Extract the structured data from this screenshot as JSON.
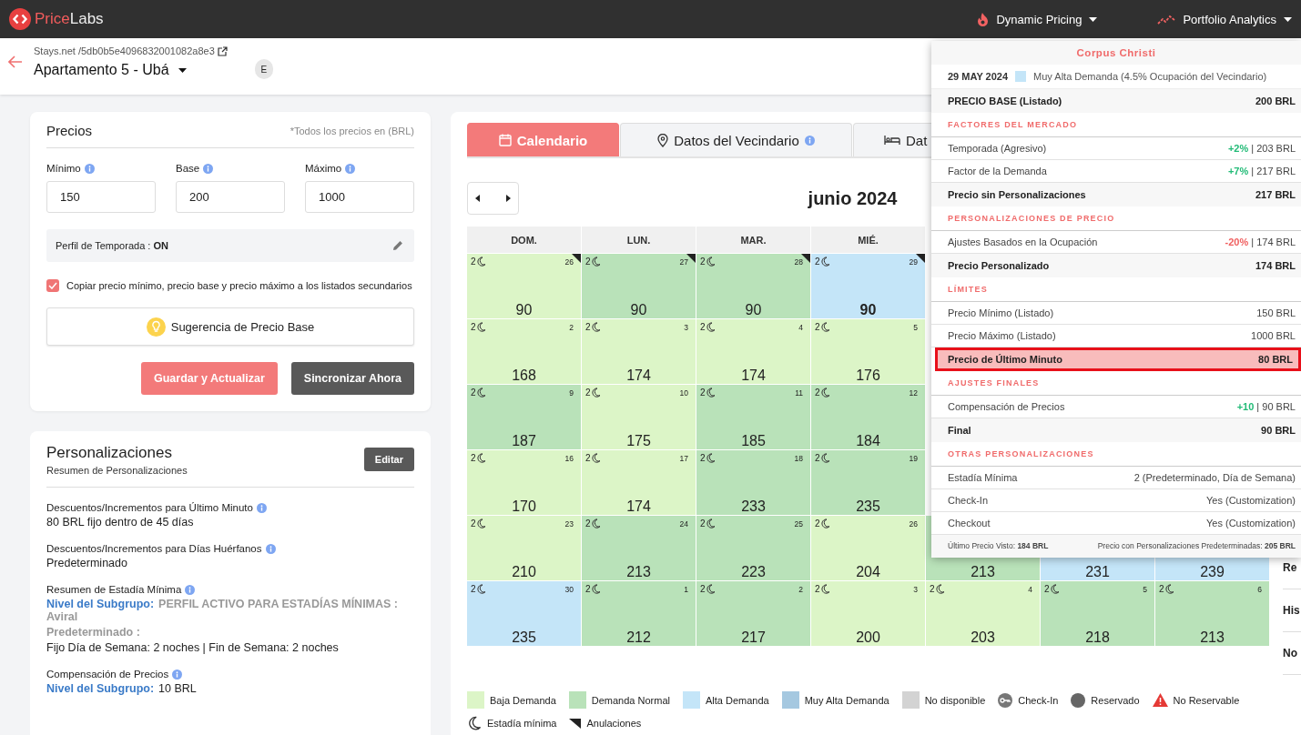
{
  "topbar": {
    "brand_first": "Price",
    "brand_second": "Labs",
    "menus": [
      {
        "label": "Dynamic Pricing"
      },
      {
        "label": "Portfolio Analytics"
      }
    ]
  },
  "listing": {
    "source": "Stays.net /5db0b5e4096832001082a8e3",
    "name": "Apartamento 5 - Ubá",
    "badge": "E"
  },
  "prices": {
    "title": "Precios",
    "note": "*Todos los precios en (BRL)",
    "fields": [
      {
        "label": "Mínimo",
        "value": "150"
      },
      {
        "label": "Base",
        "value": "200"
      },
      {
        "label": "Máximo",
        "value": "1000"
      }
    ],
    "season_profile": "Perfil de Temporada : **ON**",
    "copy_option": {
      "label": "Copiar precio mínimo, precio base y precio máximo a los listados secundarios",
      "checked": true
    },
    "suggest_button": "Sugerencia de Precio Base",
    "buttons": [
      {
        "label": "Guardar y Actualizar",
        "kind": "primary"
      },
      {
        "label": "Sincronizar Ahora",
        "kind": "dark"
      }
    ]
  },
  "customizations": {
    "title": "Personalizaciones",
    "subtitle": "Resumen de Personalizaciones",
    "edit_button": "Editar",
    "items": [
      {
        "label": "Descuentos/Incrementos para Último Minuto",
        "lines": [
          {
            "text": "80 BRL fijo dentro de 45 días",
            "muted": false
          }
        ]
      },
      {
        "label": "Descuentos/Incrementos para Días Huérfanos",
        "lines": [
          {
            "text": "Predeterminado",
            "muted": false
          }
        ]
      },
      {
        "label": "Resumen de Estadía Mínima",
        "lines": [
          {
            "lead": "Nivel del Subgrupo:",
            "text": "PERFIL ACTIVO PARA ESTADÍAS MÍNIMAS : Aviral",
            "muted": true
          },
          {
            "text": "Predeterminado :",
            "muted": true
          },
          {
            "text": "Fijo Día de Semana: 2 noches | Fin de Semana: 2 noches",
            "muted": false
          }
        ]
      },
      {
        "label": "Compensación de Precios",
        "lines": [
          {
            "lead": "Nivel del Subgrupo:",
            "text": "10 BRL",
            "muted": false
          }
        ]
      }
    ]
  },
  "calendar": {
    "tabs": [
      {
        "label": "Calendario",
        "info": false,
        "selected": true
      },
      {
        "label": "Datos del Vecindario",
        "info": true,
        "selected": false
      },
      {
        "label": "Dat",
        "info": false,
        "selected": false
      }
    ],
    "month": "junio 2024",
    "weekdays": [
      "DOM.",
      "LUN.",
      "MAR.",
      "MIÉ."
    ],
    "weeks": [
      [
        {
          "day": "26",
          "min_stay": "2",
          "price": "90",
          "color": "#dcf5c7",
          "cancellation": true,
          "selected": false
        },
        {
          "day": "27",
          "min_stay": "2",
          "price": "90",
          "color": "#b9e2b9",
          "cancellation": true,
          "selected": false
        },
        {
          "day": "28",
          "min_stay": "2",
          "price": "90",
          "color": "#b9e2b9",
          "cancellation": true,
          "selected": false
        },
        {
          "day": "29",
          "min_stay": "2",
          "price": "90",
          "color": "#c4e5f8",
          "cancellation": true,
          "selected": true
        }
      ],
      [
        {
          "day": "2",
          "min_stay": "2",
          "price": "168",
          "color": "#dcf5c7",
          "cancellation": false,
          "selected": false
        },
        {
          "day": "3",
          "min_stay": "2",
          "price": "174",
          "color": "#dcf5c7",
          "cancellation": false,
          "selected": false
        },
        {
          "day": "4",
          "min_stay": "2",
          "price": "174",
          "color": "#dcf5c7",
          "cancellation": false,
          "selected": false
        },
        {
          "day": "5",
          "min_stay": "2",
          "price": "176",
          "color": "#dcf5c7",
          "cancellation": false,
          "selected": false
        }
      ],
      [
        {
          "day": "9",
          "min_stay": "2",
          "price": "187",
          "color": "#b9e2b9",
          "cancellation": false,
          "selected": false
        },
        {
          "day": "10",
          "min_stay": "2",
          "price": "175",
          "color": "#dcf5c7",
          "cancellation": false,
          "selected": false
        },
        {
          "day": "11",
          "min_stay": "2",
          "price": "185",
          "color": "#b9e2b9",
          "cancellation": false,
          "selected": false
        },
        {
          "day": "12",
          "min_stay": "2",
          "price": "184",
          "color": "#b9e2b9",
          "cancellation": false,
          "selected": false
        }
      ],
      [
        {
          "day": "16",
          "min_stay": "2",
          "price": "170",
          "color": "#dcf5c7",
          "cancellation": false,
          "selected": false
        },
        {
          "day": "17",
          "min_stay": "2",
          "price": "174",
          "color": "#dcf5c7",
          "cancellation": false,
          "selected": false
        },
        {
          "day": "18",
          "min_stay": "2",
          "price": "233",
          "color": "#b9e2b9",
          "cancellation": false,
          "selected": false
        },
        {
          "day": "19",
          "min_stay": "2",
          "price": "235",
          "color": "#b9e2b9",
          "cancellation": false,
          "selected": false
        }
      ],
      [
        {
          "day": "23",
          "min_stay": "2",
          "price": "210",
          "color": "#dcf5c7",
          "cancellation": false,
          "selected": false
        },
        {
          "day": "24",
          "min_stay": "2",
          "price": "213",
          "color": "#b9e2b9",
          "cancellation": false,
          "selected": false
        },
        {
          "day": "25",
          "min_stay": "2",
          "price": "223",
          "color": "#b9e2b9",
          "cancellation": false,
          "selected": false
        },
        {
          "day": "26",
          "min_stay": "2",
          "price": "204",
          "color": "#dcf5c7",
          "cancellation": false,
          "selected": false
        },
        {
          "price": "213",
          "color": "#b9e2b9",
          "selected": false
        },
        {
          "price": "231",
          "color": "#c4e5f8",
          "selected": false
        },
        {
          "price": "239",
          "color": "#c4e5f8",
          "selected": false
        }
      ],
      [
        {
          "day": "30",
          "min_stay": "2",
          "price": "235",
          "color": "#c4e5f8",
          "cancellation": false,
          "selected": false
        },
        {
          "day": "1",
          "min_stay": "2",
          "price": "212",
          "color": "#b9e2b9",
          "cancellation": false,
          "selected": false
        },
        {
          "day": "2",
          "min_stay": "2",
          "price": "217",
          "color": "#b9e2b9",
          "cancellation": false,
          "selected": false
        },
        {
          "day": "3",
          "min_stay": "2",
          "price": "200",
          "color": "#dcf5c7",
          "cancellation": false,
          "selected": false
        },
        {
          "day": "4",
          "min_stay": "2",
          "price": "203",
          "color": "#dcf5c7",
          "cancellation": false,
          "selected": false
        },
        {
          "day": "5",
          "min_stay": "2",
          "price": "218",
          "color": "#b9e2b9",
          "cancellation": false,
          "selected": false
        },
        {
          "day": "6",
          "min_stay": "2",
          "price": "213",
          "color": "#b9e2b9",
          "cancellation": false,
          "selected": false
        }
      ]
    ],
    "legend": [
      {
        "kind": "swatch",
        "label": "Baja Demanda",
        "color": "#dcf5c7"
      },
      {
        "kind": "swatch",
        "label": "Demanda Normal",
        "color": "#b9e2b9"
      },
      {
        "kind": "swatch",
        "label": "Alta Demanda",
        "color": "#c4e5f8"
      },
      {
        "kind": "swatch",
        "label": "Muy Alta Demanda",
        "color": "#a5c8e0"
      },
      {
        "kind": "swatch",
        "label": "No disponible",
        "color": "#d3d3d3"
      },
      {
        "kind": "key",
        "label": "Check-In"
      },
      {
        "kind": "dot",
        "label": "Reservado"
      },
      {
        "kind": "warning",
        "label": "No Reservable"
      },
      {
        "kind": "moon",
        "label": "Estadía mínima"
      },
      {
        "kind": "corner",
        "label": "Anulaciones"
      }
    ],
    "side_items": [
      "Re",
      "His",
      "No"
    ]
  },
  "popup": {
    "title": "Corpus Christi",
    "date": "29 MAY 2024",
    "demand_text": "Muy Alta Demanda (4.5% Ocupación del Vecindario)",
    "rows": [
      {
        "kind": "total",
        "label": "PRECIO BASE (Listado)",
        "value": "200 BRL"
      },
      {
        "kind": "section",
        "label": "FACTORES DEL MERCADO"
      },
      {
        "kind": "line",
        "label": "Temporada (Agresivo)",
        "change": "+2%",
        "increase": true,
        "separator": "|",
        "value": "203 BRL"
      },
      {
        "kind": "line",
        "label": "Factor de la Demanda",
        "change": "+7%",
        "increase": true,
        "separator": "|",
        "value": "217 BRL"
      },
      {
        "kind": "total",
        "label": "Precio sin Personalizaciones",
        "value": "217 BRL"
      },
      {
        "kind": "section",
        "label": "PERSONALIZACIONES DE PRECIO"
      },
      {
        "kind": "line",
        "label": "Ajustes Basados en la Ocupación",
        "change": "-20%",
        "increase": false,
        "separator": "|",
        "value": "174 BRL"
      },
      {
        "kind": "total",
        "label": "Precio Personalizado",
        "value": "174 BRL"
      },
      {
        "kind": "section",
        "label": "LÍMITES"
      },
      {
        "kind": "line",
        "label": "Precio Mínimo (Listado)",
        "value": "150 BRL"
      },
      {
        "kind": "line",
        "label": "Precio Máximo (Listado)",
        "value": "1000 BRL"
      },
      {
        "kind": "highlight",
        "label": "Precio de Último Minuto",
        "value": "80 BRL"
      },
      {
        "kind": "section",
        "label": "AJUSTES FINALES"
      },
      {
        "kind": "line",
        "label": "Compensación de Precios",
        "change": "+10",
        "increase": true,
        "separator": "|",
        "value": "90 BRL"
      },
      {
        "kind": "total",
        "label": "Final",
        "value": "90 BRL"
      },
      {
        "kind": "section",
        "label": "OTRAS PERSONALIZACIONES"
      },
      {
        "kind": "line",
        "label": "Estadía Mínima",
        "value": "2 (Predeterminado, Día de Semana)"
      },
      {
        "kind": "line",
        "label": "Check-In",
        "value": "Yes (Customization)"
      },
      {
        "kind": "line",
        "label": "Checkout",
        "value": "Yes (Customization)"
      }
    ],
    "footer_left": "Último Precio Visto: **184 BRL**",
    "footer_right": "Precio con Personalizaciones Predeterminadas: **205 BRL**"
  }
}
